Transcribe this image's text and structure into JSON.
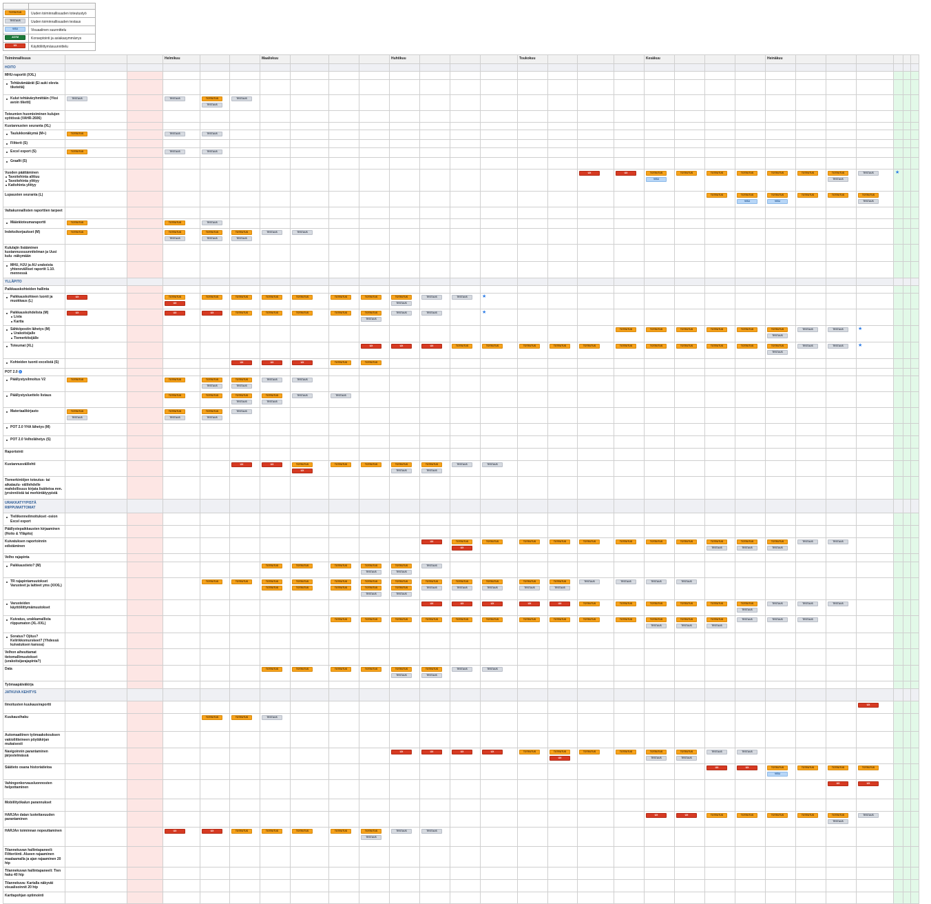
{
  "legend": [
    {
      "badge": "TOTEUTUS",
      "cls": "b-tot",
      "text": "Uuden toiminnallisuuden toteutustyö"
    },
    {
      "badge": "TESTAUS",
      "cls": "b-tes",
      "text": "Uuden toiminnallisuuden testaus"
    },
    {
      "badge": "VISU",
      "cls": "b-vis",
      "text": "Visuaalinen suunnittelu"
    },
    {
      "badge": "ASYM",
      "cls": "b-kon",
      "text": "Konseptointi ja asiakasymmärrys"
    },
    {
      "badge": "UX",
      "cls": "b-ux",
      "text": "Käyttöliittymäsuunnittelu"
    }
  ],
  "header": {
    "col0": "Toiminnallisuus",
    "months": [
      "",
      "",
      "Helmikuu",
      "",
      "",
      "Maaliskuu",
      "",
      "",
      "",
      "Huhtikuu",
      "",
      "",
      "",
      "Toukokuu",
      "",
      "",
      "",
      "Kesäkuu",
      "",
      "",
      "",
      "Heinäkuu",
      "",
      "",
      ""
    ]
  },
  "labels": {
    "TOT": "TOTEUTUS",
    "TES": "TESTAUS",
    "VIS": "VISU",
    "UX": "UX",
    "KON": "ASYM",
    "star": "★"
  },
  "rows": [
    {
      "name": "HOITO",
      "type": "sec"
    },
    {
      "name": "MHU-raportit (XXL)"
    },
    {
      "name": "Tehtävämäärät (Ei auki olevia tiketeitä)",
      "sub": true
    },
    {
      "name": "Kulut tehtäväryhmittäin (Yksi avoin tiketti)",
      "sub": true,
      "cells": {
        "0": [
          "TES"
        ],
        "2": [
          "TES"
        ],
        "3": [
          "TOT",
          "TES"
        ],
        "4": [
          "TES"
        ]
      }
    },
    {
      "name": "Toteumien huomioiminen kulujen syötössä (VAHR-2606)"
    },
    {
      "name": "Kustannusten seuranta (XL)"
    },
    {
      "name": "Taulukkonäkymä (M+)",
      "sub": true,
      "cells": {
        "0": [
          "TOT"
        ],
        "2": [
          "TES"
        ],
        "3": [
          "TES"
        ]
      }
    },
    {
      "name": "Filtterit (S)",
      "sub": true
    },
    {
      "name": "Excel export (S)",
      "sub": true,
      "cells": {
        "0": [
          "TOT"
        ],
        "2": [
          "TES"
        ],
        "3": [
          "TES"
        ]
      }
    },
    {
      "name": "Graafit (S)",
      "sub": true
    },
    {
      "name": "Vuoden päättäminen",
      "bullets": [
        "Tavoitehinta alittuu",
        "Tavoitehinta ylittyy",
        "Kattohinta ylittyy"
      ],
      "cells": {
        "15": [
          "UX"
        ],
        "16": [
          "UX"
        ],
        "17": [
          "TOT",
          "VIS"
        ],
        "18": [
          "TOT"
        ],
        "19": [
          "TOT"
        ],
        "20": [
          "TOT"
        ],
        "21": [
          "TOT"
        ],
        "22": [
          "TOT"
        ],
        "23": [
          "TOT",
          "TES"
        ],
        "24": [
          "TES"
        ],
        "25": [
          "star"
        ]
      }
    },
    {
      "name": "Lupausten seuranta (L)",
      "cells": {
        "19": [
          "TOT"
        ],
        "20": [
          "TOT",
          "VIS"
        ],
        "21": [
          "TOT",
          "VIS"
        ],
        "22": [
          "TOT"
        ],
        "23": [
          "TOT"
        ],
        "24": [
          "TOT",
          "TES"
        ]
      }
    },
    {
      "name": "Valtakunnallisten raporttien tarpeet"
    },
    {
      "name": "Määrätoteumaraportti",
      "sub": true,
      "cells": {
        "0": [
          "TOT"
        ],
        "2": [
          "TOT"
        ],
        "3": [
          "TES"
        ]
      }
    },
    {
      "name": "Indeksikorjaukset (M)",
      "cells": {
        "0": [
          "TOT"
        ],
        "2": [
          "TOT",
          "TES"
        ],
        "3": [
          "TOT",
          "TES"
        ],
        "4": [
          "TOT",
          "TES"
        ],
        "5": [
          "TES"
        ],
        "6": [
          "TES"
        ]
      }
    },
    {
      "name": "Kululajin lisääminen kustannussuunnitelman ja Uusi kulu -näkymään"
    },
    {
      "name": "MHU, HJU ja AU urakoista yhtenevälliset raportit 1.10. mennessä",
      "sub": true
    },
    {
      "name": "YLLÄPITO",
      "type": "sec"
    },
    {
      "name": "Paikkauskohteiden hallinta"
    },
    {
      "name": "Paikkauskohteen luonti ja muokkaus (L)",
      "sub": true,
      "cells": {
        "0": [
          "UX"
        ],
        "2": [
          "TOT",
          "UX"
        ],
        "3": [
          "TOT"
        ],
        "4": [
          "TOT"
        ],
        "5": [
          "TOT"
        ],
        "6": [
          "TOT"
        ],
        "7": [
          "TOT"
        ],
        "8": [
          "TOT"
        ],
        "9": [
          "TOT",
          "TES"
        ],
        "10": [
          "TES"
        ],
        "11": [
          "TES"
        ],
        "12": [
          "star"
        ]
      }
    },
    {
      "name": "Paikkauskohdelista (M)",
      "sub": true,
      "bullets": [
        "Lista",
        "Kartta"
      ],
      "cells": {
        "0": [
          "UX"
        ],
        "2": [
          "UX"
        ],
        "3": [
          "UX"
        ],
        "4": [
          "TOT"
        ],
        "5": [
          "TOT"
        ],
        "6": [
          "TOT"
        ],
        "7": [
          "TOT"
        ],
        "8": [
          "TOT",
          "TES"
        ],
        "9": [
          "TES"
        ],
        "10": [
          "TES"
        ],
        "12": [
          "star"
        ]
      }
    },
    {
      "name": "Sähköpostin lähetys (M)",
      "sub": true,
      "bullets": [
        "Urakoitsijalle",
        "Tiemerkitsijälle"
      ],
      "cells": {
        "16": [
          "TOT"
        ],
        "17": [
          "TOT"
        ],
        "18": [
          "TOT"
        ],
        "19": [
          "TOT"
        ],
        "20": [
          "TOT"
        ],
        "21": [
          "TOT",
          "TES"
        ],
        "22": [
          "TES"
        ],
        "23": [
          "TES"
        ],
        "24": [
          "star"
        ]
      }
    },
    {
      "name": "Toteumat (XL)",
      "sub": true,
      "cells": {
        "8": [
          "UX"
        ],
        "9": [
          "UX"
        ],
        "10": [
          "UX"
        ],
        "11": [
          "TOT"
        ],
        "12": [
          "TOT"
        ],
        "13": [
          "TOT"
        ],
        "14": [
          "TOT"
        ],
        "15": [
          "TOT"
        ],
        "16": [
          "TOT"
        ],
        "17": [
          "TOT"
        ],
        "18": [
          "TOT"
        ],
        "19": [
          "TOT"
        ],
        "20": [
          "TOT"
        ],
        "21": [
          "TOT",
          "TES"
        ],
        "22": [
          "TES"
        ],
        "23": [
          "TES"
        ],
        "24": [
          "star"
        ]
      }
    },
    {
      "name": "Kohteiden tuonti excelistä (S)",
      "sub": true,
      "cells": {
        "4": [
          "UX"
        ],
        "5": [
          "UX"
        ],
        "6": [
          "UX"
        ],
        "7": [
          "TOT"
        ],
        "8": [
          "TOT"
        ]
      }
    },
    {
      "name": "POT 2.0",
      "help": true
    },
    {
      "name": "Päällystysilmoitus V2",
      "sub": true,
      "cells": {
        "0": [
          "TOT"
        ],
        "2": [
          "TOT"
        ],
        "3": [
          "TOT",
          "TES"
        ],
        "4": [
          "TOT",
          "TES"
        ],
        "5": [
          "TES"
        ],
        "6": [
          "TES"
        ]
      }
    },
    {
      "name": "Päällystysluettelo listaus",
      "sub": true,
      "cells": {
        "2": [
          "TOT"
        ],
        "3": [
          "TOT"
        ],
        "4": [
          "TOT",
          "TES"
        ],
        "5": [
          "TOT",
          "TES"
        ],
        "6": [
          "TES"
        ],
        "7": [
          "TES"
        ]
      }
    },
    {
      "name": "Materiaalikirjasto",
      "sub": true,
      "cells": {
        "0": [
          "TOT",
          "TES"
        ],
        "2": [
          "TOT",
          "TES"
        ],
        "3": [
          "TOT",
          "TES"
        ],
        "4": [
          "TES"
        ]
      }
    },
    {
      "name": "POT 2.0 YHA lähetys (M)",
      "sub": true
    },
    {
      "name": "POT 2.0 Velholähetys (S)",
      "sub": true
    },
    {
      "name": "Raportointi"
    },
    {
      "name": "Kustannusvälilehti",
      "cells": {
        "4": [
          "UX"
        ],
        "5": [
          "UX"
        ],
        "6": [
          "TOT",
          "UX"
        ],
        "7": [
          "TOT"
        ],
        "8": [
          "TOT"
        ],
        "9": [
          "TOT",
          "TES"
        ],
        "10": [
          "TOT",
          "TES"
        ],
        "11": [
          "TES"
        ],
        "12": [
          "TES"
        ]
      }
    },
    {
      "name": "Tiemerkintöjen toteutus- tai aikataulu- välilehdelle mahdollisuus kirjata lisätietoa mm. jyrsinnöistä tai merkintätyypistä"
    },
    {
      "name": "URAKKATYYPISTÄ RIIPPUMATTOMAT",
      "type": "sec"
    },
    {
      "name": "Tieliikenneilmoitukset -osion Excel export",
      "sub": true
    },
    {
      "name": "Päällystepaikkausten kirjaaminen (Hoito & Ylläpito)"
    },
    {
      "name": "Kuivatuksen raportoinnin edistäminen",
      "cells": {
        "10": [
          "UX"
        ],
        "11": [
          "TOT",
          "UX"
        ],
        "12": [
          "TOT"
        ],
        "13": [
          "TOT"
        ],
        "14": [
          "TOT"
        ],
        "15": [
          "TOT"
        ],
        "16": [
          "TOT"
        ],
        "17": [
          "TOT"
        ],
        "18": [
          "TOT"
        ],
        "19": [
          "TOT",
          "TES"
        ],
        "20": [
          "TOT",
          "TES"
        ],
        "21": [
          "TOT",
          "TES"
        ],
        "22": [
          "TES"
        ],
        "23": [
          "TES"
        ]
      }
    },
    {
      "name": "Velho rajapinta"
    },
    {
      "name": "Paikkaustieto? (M)",
      "sub": true,
      "cells": {
        "5": [
          "TOT"
        ],
        "6": [
          "TOT"
        ],
        "7": [
          "TOT"
        ],
        "8": [
          "TOT",
          "TES"
        ],
        "9": [
          "TOT",
          "TES"
        ],
        "10": [
          "TES"
        ]
      }
    },
    {
      "name": "TR rajapintamuutokset Varusteet ja laitteet yms (XXXL)",
      "sub": true,
      "cells": {
        "3": [
          "TOT"
        ],
        "4": [
          "TOT"
        ],
        "5": [
          "TOT",
          "TOT"
        ],
        "6": [
          "TOT",
          "TOT"
        ],
        "7": [
          "TOT",
          "TOT"
        ],
        "8": [
          "TOT",
          "TOT",
          "TES"
        ],
        "9": [
          "TOT",
          "TOT",
          "TES"
        ],
        "10": [
          "TOT",
          "TES"
        ],
        "11": [
          "TOT",
          "TES"
        ],
        "12": [
          "TOT",
          "TES"
        ],
        "13": [
          "TOT",
          "TES"
        ],
        "14": [
          "TOT",
          "TES"
        ],
        "15": [
          "TES"
        ],
        "16": [
          "TES"
        ],
        "17": [
          "TES"
        ],
        "18": [
          "TES"
        ]
      }
    },
    {
      "name": "Varusteiden käyttöliittymämuutokset",
      "sub": true,
      "cells": {
        "10": [
          "UX"
        ],
        "11": [
          "UX"
        ],
        "12": [
          "UX"
        ],
        "13": [
          "UX"
        ],
        "14": [
          "UX"
        ],
        "15": [
          "TOT"
        ],
        "16": [
          "TOT"
        ],
        "17": [
          "TOT"
        ],
        "18": [
          "TOT"
        ],
        "19": [
          "TOT"
        ],
        "20": [
          "TOT",
          "TES"
        ],
        "21": [
          "TES"
        ],
        "22": [
          "TES"
        ],
        "23": [
          "TES"
        ]
      }
    },
    {
      "name": "Kuivatus, urakkamallista riippumaton (XL-XXL)",
      "sub": true,
      "cells": {
        "7": [
          "TOT"
        ],
        "8": [
          "TOT"
        ],
        "9": [
          "TOT"
        ],
        "10": [
          "TOT"
        ],
        "11": [
          "TOT"
        ],
        "12": [
          "TOT"
        ],
        "13": [
          "TOT"
        ],
        "14": [
          "TOT"
        ],
        "15": [
          "TOT"
        ],
        "16": [
          "TOT"
        ],
        "17": [
          "TOT",
          "TES"
        ],
        "18": [
          "TOT",
          "TES"
        ],
        "19": [
          "TOT",
          "TES"
        ],
        "20": [
          "TES"
        ],
        "21": [
          "TES"
        ],
        "22": [
          "TES"
        ]
      }
    },
    {
      "name": "Soratus? Ojitus? Kelirikkomurskeet? (Yhdessä kuivatuksen kanssa)",
      "sub": true
    },
    {
      "name": "Velhon aiheuttamat tietomallimuutokset (urakoitsijarajapinta?)"
    },
    {
      "name": "Data",
      "cells": {
        "5": [
          "TOT"
        ],
        "6": [
          "TOT"
        ],
        "7": [
          "TOT"
        ],
        "8": [
          "TOT"
        ],
        "9": [
          "TOT",
          "TES"
        ],
        "10": [
          "TOT",
          "TES"
        ],
        "11": [
          "TES"
        ],
        "12": [
          "TES"
        ]
      }
    },
    {
      "name": "Työmaapäiväkirja"
    },
    {
      "name": "JATKUVA KEHITYS",
      "type": "sec"
    },
    {
      "name": "Ilmoitusten kuukausiraportti",
      "cells": {
        "24": [
          "UX"
        ]
      }
    },
    {
      "name": "Kuukausihaku",
      "cells": {
        "3": [
          "TOT"
        ],
        "4": [
          "TOT"
        ],
        "5": [
          "TES"
        ]
      }
    },
    {
      "name": "Automaattinen työmaakokouksen vakioliitteineen pöytäkirjan mukaisesti"
    },
    {
      "name": "Navigoinnin parantaminen järjestelmässä",
      "cells": {
        "9": [
          "UX"
        ],
        "10": [
          "UX"
        ],
        "11": [
          "UX"
        ],
        "12": [
          "UX"
        ],
        "13": [
          "TOT"
        ],
        "14": [
          "TOT",
          "UX"
        ],
        "15": [
          "TOT"
        ],
        "16": [
          "TOT"
        ],
        "17": [
          "TOT",
          "TES"
        ],
        "18": [
          "TOT",
          "TES"
        ],
        "19": [
          "TES"
        ],
        "20": [
          "TES"
        ]
      }
    },
    {
      "name": "Säätieto osana historiatietoa",
      "cells": {
        "19": [
          "UX"
        ],
        "20": [
          "UX"
        ],
        "21": [
          "TOT",
          "VIS"
        ],
        "22": [
          "TOT"
        ],
        "23": [
          "TOT"
        ],
        "24": [
          "TOT"
        ]
      }
    },
    {
      "name": "Vahingonkorvausluonnosten helpottaminen",
      "cells": {
        "23": [
          "UX"
        ],
        "24": [
          "UX"
        ]
      }
    },
    {
      "name": "Mobiilityökalun parannukset"
    },
    {
      "name": "HARJAn datan luotettavuuden parantaminen",
      "cells": {
        "17": [
          "UX"
        ],
        "18": [
          "UX"
        ],
        "19": [
          "TOT"
        ],
        "20": [
          "TOT"
        ],
        "21": [
          "TOT"
        ],
        "22": [
          "TOT"
        ],
        "23": [
          "TOT",
          "TES"
        ],
        "24": [
          "TES"
        ]
      }
    },
    {
      "name": "HARJAn toiminnan nopeuttaminen",
      "cells": {
        "2": [
          "UX"
        ],
        "3": [
          "UX"
        ],
        "4": [
          "TOT"
        ],
        "5": [
          "TOT"
        ],
        "6": [
          "TOT"
        ],
        "7": [
          "TOT"
        ],
        "8": [
          "TOT",
          "TES"
        ],
        "9": [
          "TES"
        ],
        "10": [
          "TES"
        ]
      }
    },
    {
      "name": "Tilannekuvan hallintapaneeli: Filtteröinti. Alueen rajaaminen maalaamalla ja ajan rajaaminen 20 htp"
    },
    {
      "name": "Tilannekuvan hallintapaneeli: Tien haku 40 htp"
    },
    {
      "name": "Tilannekuva: Kartalla näkyvät visualisoinnit 20 htp"
    },
    {
      "name": "Karttapohjan optimointi"
    }
  ]
}
